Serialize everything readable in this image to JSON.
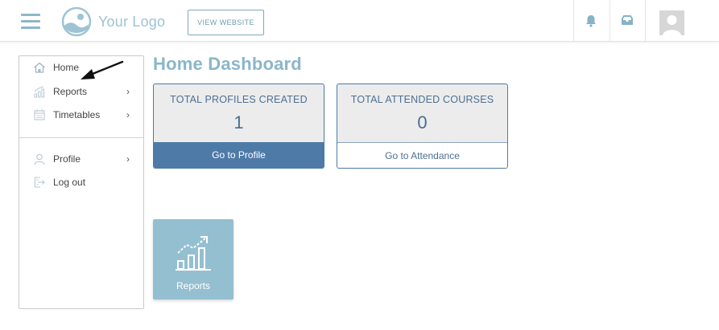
{
  "header": {
    "logo_text": "Your Logo",
    "view_website_label": "VIEW WEBSITE",
    "accent_color": "#8ab6c9"
  },
  "sidebar": {
    "items": [
      {
        "label": "Home",
        "icon": "home-icon",
        "has_submenu": false
      },
      {
        "label": "Reports",
        "icon": "reports-icon",
        "has_submenu": true
      },
      {
        "label": "Timetables",
        "icon": "calendar-icon",
        "has_submenu": true
      },
      {
        "label": "Profile",
        "icon": "user-icon",
        "has_submenu": true
      },
      {
        "label": "Log out",
        "icon": "logout-icon",
        "has_submenu": false
      }
    ],
    "chevron": "›"
  },
  "main": {
    "title": "Home Dashboard",
    "cards": [
      {
        "label": "TOTAL PROFILES CREATED",
        "value": "1",
        "action": "Go to Profile"
      },
      {
        "label": "TOTAL ATTENDED COURSES",
        "value": "0",
        "action": "Go to Attendance"
      }
    ],
    "tile": {
      "label": "Reports",
      "icon": "growth-chart-icon"
    }
  }
}
